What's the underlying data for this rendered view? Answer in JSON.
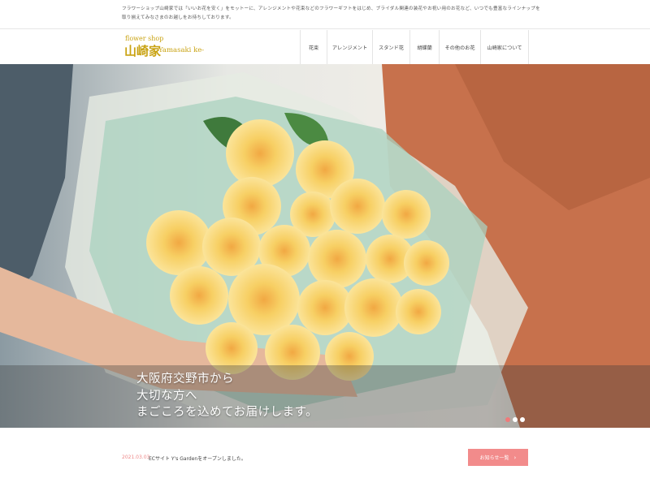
{
  "topbar": {
    "intro": "フラワーショップ山崎家では「いいお花を安く」をモットーに、アレンジメントや花束などのフラワーギフトをはじめ、ブライダル関連の装花やお祝い用のお花など、いつでも豊富なラインナップを取り揃えてみなさまのお越しをお待ちしております。"
  },
  "logo": {
    "small": "flower shop",
    "kanji": "山崎家",
    "roman": "-Yamasaki ke-"
  },
  "nav": [
    {
      "label": "花束"
    },
    {
      "label": "アレンジメント"
    },
    {
      "label": "スタンド花"
    },
    {
      "label": "胡蝶蘭"
    },
    {
      "label": "その他のお花"
    },
    {
      "label": "山崎家について"
    }
  ],
  "hero": {
    "caption": [
      "大阪府交野市から",
      "大切な方へ",
      "まごころを込めてお届けします。"
    ],
    "slides": 3,
    "active_slide": 1
  },
  "news": {
    "date": "2021.03.03",
    "text": "ECサイト Y's Gardenをオープンしました。",
    "button_label": "お知らせ一覧",
    "button_arrow": "›"
  },
  "colors": {
    "logo_gold": "#c9a313",
    "accent_pink": "#f28b8b",
    "rose_yellow": "#f7d36a"
  }
}
